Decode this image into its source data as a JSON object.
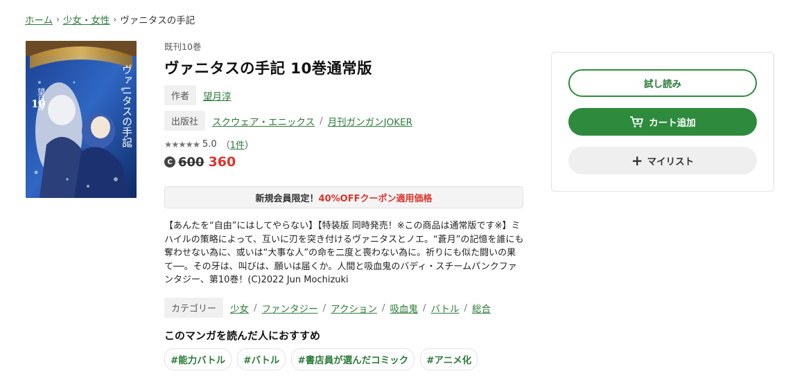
{
  "breadcrumb": {
    "items": [
      "ホーム",
      "少女・女性"
    ],
    "current": "ヴァニタスの手記"
  },
  "cover": {
    "author_text": "望月淳",
    "title_text": "ヴァニタスの手記",
    "volume_text": "10"
  },
  "book": {
    "volume_count": "既刊10巻",
    "title": "ヴァニタスの手記 10巻通常版",
    "author_label": "作者",
    "author": "望月淳",
    "publisher_label": "出版社",
    "publisher": "スクウェア・エニックス",
    "magazine": "月刊ガンガンJOKER",
    "stars": "★★★★★",
    "rating": "5.0",
    "review_count": "1件",
    "price_old": "600",
    "price_new": "360",
    "coin_symbol": "C"
  },
  "coupon": {
    "prefix": "新規会員限定！",
    "highlight": "40%OFFクーポン適用価格"
  },
  "description": "【あんたを“自由”にはしてやらない】【特装版 同時発売！※この商品は通常版です※】ミハイルの策略によって、互いに刃を突き付けるヴァニタスとノエ。“蒼月”の記憶を誰にも奪わせない為に、或いは“大事な人”の命を二度と喪わない為に。祈りにも似た闘いの果て──。その牙は、叫びは、願いは届くか。人間と吸血鬼のバディ・スチームパンクファンタジー、第10巻！(C)2022 Jun Mochizuki",
  "categories": {
    "label": "カテゴリー",
    "items": [
      "少女",
      "ファンタジー",
      "アクション",
      "吸血鬼",
      "バトル",
      "総合"
    ]
  },
  "recommend": {
    "title": "このマンガを読んだ人におすすめ",
    "tags": [
      "#能力バトル",
      "#バトル",
      "#書店員が選んだコミック",
      "#アニメ化"
    ]
  },
  "panel": {
    "try_label": "試し読み",
    "cart_label": "カート追加",
    "mylist_label": "マイリスト"
  },
  "colors": {
    "accent_green": "#2e8b3e",
    "price_red": "#d9342b"
  }
}
